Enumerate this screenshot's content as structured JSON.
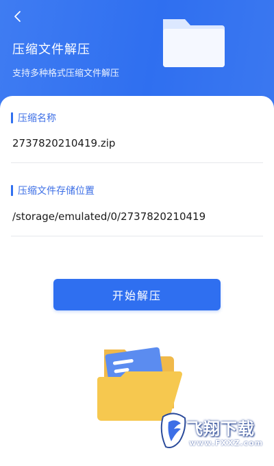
{
  "header": {
    "title": "压缩文件解压",
    "subtitle": "支持多种格式压缩文件解压"
  },
  "archive_name": {
    "label": "压缩名称",
    "value": "2737820210419.zip"
  },
  "storage_location": {
    "label": "压缩文件存储位置",
    "value": "/storage/emulated/0/2737820210419"
  },
  "actions": {
    "start_label": "开始解压"
  },
  "watermark": {
    "text": "飞翔下载",
    "sub": "www.FXXZ.com"
  },
  "colors": {
    "primary": "#2f6ff0",
    "folder_yellow": "#f6c84f"
  },
  "icons": {
    "back": "chevron-left-icon",
    "header_folder": "folder-icon",
    "bottom_folder": "open-folder-icon"
  }
}
